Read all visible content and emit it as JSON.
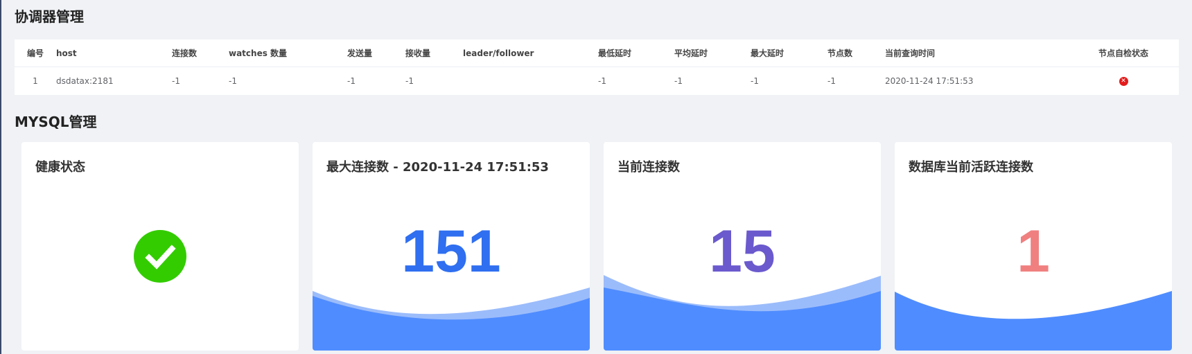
{
  "coordinator": {
    "title": "协调器管理",
    "columns": [
      "编号",
      "host",
      "连接数",
      "watches 数量",
      "发送量",
      "接收量",
      "leader/follower",
      "最低延时",
      "平均延时",
      "最大延时",
      "节点数",
      "当前查询时间",
      "节点自检状态"
    ],
    "rows": [
      {
        "index": "1",
        "host": "dsdatax:2181",
        "connections": "-1",
        "watches": "-1",
        "sent": "-1",
        "received": "-1",
        "role": "",
        "min_latency": "-1",
        "avg_latency": "-1",
        "max_latency": "-1",
        "nodes": "-1",
        "query_time": "2020-11-24 17:51:53",
        "status": "error"
      }
    ]
  },
  "mysql": {
    "title": "MYSQL管理",
    "cards": [
      {
        "title": "健康状态",
        "status": "ok",
        "icon": "check-circle-icon"
      },
      {
        "title": "最大连接数 - 2020-11-24 17:51:53",
        "value": "151",
        "color": "#2f6ff0"
      },
      {
        "title": "当前连接数",
        "value": "15",
        "color": "#6a5acd"
      },
      {
        "title": "数据库当前活跃连接数",
        "value": "1",
        "color": "#f08080"
      }
    ]
  },
  "colors": {
    "wave_main": "#4f8cff",
    "wave_light": "#9bbcfb",
    "ok_green": "#33cc00",
    "error_red": "#e31b1b"
  }
}
